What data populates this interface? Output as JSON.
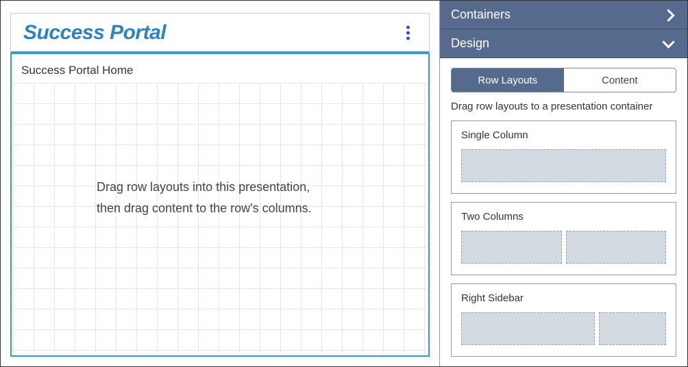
{
  "header": {
    "title": "Success Portal"
  },
  "canvas": {
    "label": "Success Portal Home",
    "hint_line1": "Drag row layouts into this presentation,",
    "hint_line2": "then drag content to the row's columns."
  },
  "panels": {
    "containers_label": "Containers",
    "design_label": "Design"
  },
  "design": {
    "tabs": {
      "row_layouts": "Row Layouts",
      "content": "Content"
    },
    "hint": "Drag row layouts to a presentation container",
    "layouts": [
      {
        "title": "Single Column"
      },
      {
        "title": "Two Columns"
      },
      {
        "title": "Right Sidebar"
      }
    ]
  }
}
